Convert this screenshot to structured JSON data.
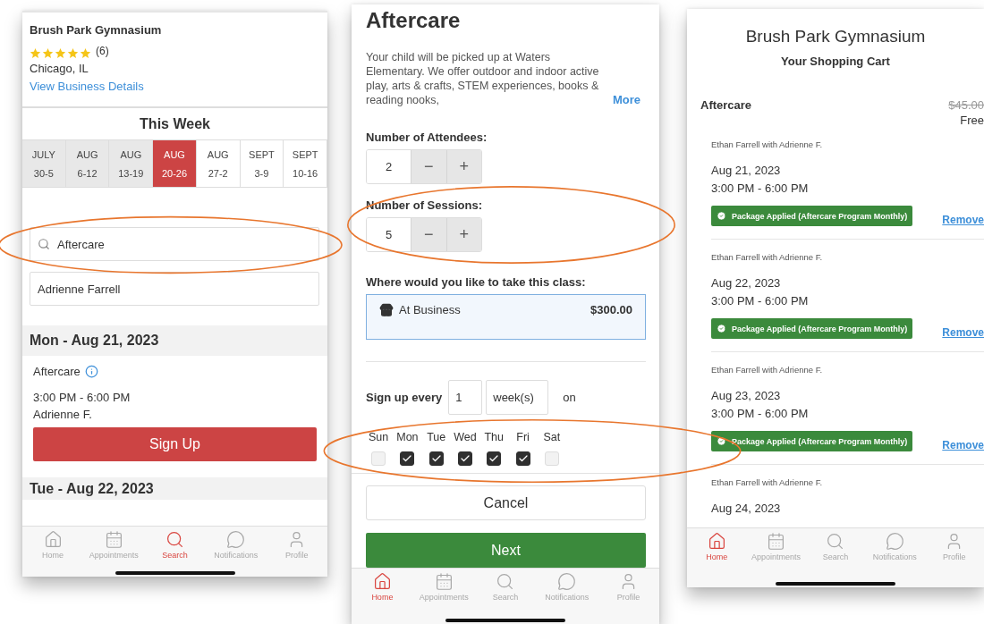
{
  "search_screen": {
    "business": {
      "name": "Brush Park Gymnasium",
      "stars": 5,
      "review_count": "(6)",
      "location": "Chicago, IL",
      "details_link": "View Business Details"
    },
    "week_title": "This Week",
    "weeks": [
      {
        "month": "JULY",
        "range": "30-5",
        "past": true,
        "selected": false
      },
      {
        "month": "AUG",
        "range": "6-12",
        "past": true,
        "selected": false
      },
      {
        "month": "AUG",
        "range": "13-19",
        "past": true,
        "selected": false
      },
      {
        "month": "AUG",
        "range": "20-26",
        "past": false,
        "selected": true
      },
      {
        "month": "AUG",
        "range": "27-2",
        "past": false,
        "selected": false
      },
      {
        "month": "SEPT",
        "range": "3-9",
        "past": false,
        "selected": false
      },
      {
        "month": "SEPT",
        "range": "10-16",
        "past": false,
        "selected": false
      }
    ],
    "search": {
      "value": "Aftercare",
      "highlighted": true
    },
    "staff_field": {
      "value": "Adrienne Farrell"
    },
    "days": [
      {
        "heading": "Mon - Aug 21, 2023",
        "classes": [
          {
            "name": "Aftercare",
            "time": "3:00 PM - 6:00 PM",
            "staff": "Adrienne F.",
            "button": "Sign Up"
          }
        ]
      },
      {
        "heading": "Tue - Aug 22, 2023"
      }
    ],
    "tab_bar": [
      {
        "label": "Home",
        "selected": false
      },
      {
        "label": "Appointments",
        "selected": false
      },
      {
        "label": "Search",
        "selected": true
      },
      {
        "label": "Notifications",
        "selected": false
      },
      {
        "label": "Profile",
        "selected": false
      }
    ]
  },
  "booking_screen": {
    "title": "Aftercare",
    "description": "Your child will be picked up at Waters Elementary. We offer outdoor and indoor active play, arts & crafts, STEM experiences, books & reading nooks,",
    "more_link": "More",
    "steppers": [
      {
        "label": "Number of Attendees:",
        "value": "2",
        "minus": "−",
        "plus": "+",
        "highlighted": false
      },
      {
        "label": "Number of Sessions:",
        "value": "5",
        "minus": "−",
        "plus": "+",
        "highlighted": true
      }
    ],
    "location_label": "Where would you like to take this class:",
    "location_option": {
      "name": "At Business",
      "price": "$300.00",
      "selected": true
    },
    "repeat": {
      "label": "Sign up every",
      "interval": "1",
      "unit": "week(s)",
      "suffix": "on"
    },
    "weekdays": [
      {
        "label": "Sun",
        "checked": false
      },
      {
        "label": "Mon",
        "checked": true
      },
      {
        "label": "Tue",
        "checked": true
      },
      {
        "label": "Wed",
        "checked": true
      },
      {
        "label": "Thu",
        "checked": true
      },
      {
        "label": "Fri",
        "checked": true
      },
      {
        "label": "Sat",
        "checked": false
      }
    ],
    "weekdays_highlighted": true,
    "cancel_button": "Cancel",
    "next_button": "Next",
    "tab_bar": [
      {
        "label": "Home",
        "selected": true
      },
      {
        "label": "Appointments",
        "selected": false
      },
      {
        "label": "Search",
        "selected": false
      },
      {
        "label": "Notifications",
        "selected": false
      },
      {
        "label": "Profile",
        "selected": false
      }
    ]
  },
  "cart_screen": {
    "business": "Brush Park Gymnasium",
    "subtitle": "Your Shopping Cart",
    "line": {
      "name": "Aftercare",
      "old_price": "$45.00",
      "price": "Free"
    },
    "items": [
      {
        "attendee": "Ethan Farrell with Adrienne F.",
        "date": "Aug 21, 2023",
        "time": "3:00 PM - 6:00 PM",
        "package": "Package Applied (Aftercare Program Monthly)",
        "remove": "Remove"
      },
      {
        "attendee": "Ethan Farrell with Adrienne F.",
        "date": "Aug 22, 2023",
        "time": "3:00 PM - 6:00 PM",
        "package": "Package Applied (Aftercare Program Monthly)",
        "remove": "Remove"
      },
      {
        "attendee": "Ethan Farrell with Adrienne F.",
        "date": "Aug 23, 2023",
        "time": "3:00 PM - 6:00 PM",
        "package": "Package Applied (Aftercare Program Monthly)",
        "remove": "Remove"
      },
      {
        "attendee": "Ethan Farrell with Adrienne F.",
        "date": "Aug 24, 2023"
      }
    ],
    "tab_bar": [
      {
        "label": "Home",
        "selected": true
      },
      {
        "label": "Appointments",
        "selected": false
      },
      {
        "label": "Search",
        "selected": false
      },
      {
        "label": "Notifications",
        "selected": false
      },
      {
        "label": "Profile",
        "selected": false
      }
    ]
  }
}
